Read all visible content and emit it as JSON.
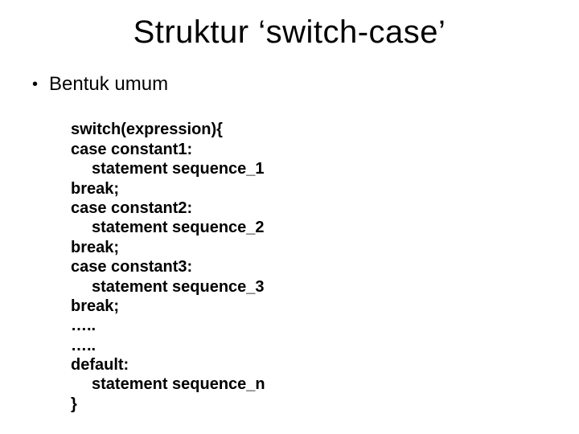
{
  "title": "Struktur ‘switch-case’",
  "bullet": {
    "marker": "•",
    "text": "Bentuk umum"
  },
  "code": {
    "l1": "switch(expression){",
    "l2": "case constant1:",
    "l3": "statement sequence_1",
    "l4": "break;",
    "l5": "case constant2:",
    "l6": "statement sequence_2",
    "l7": "break;",
    "l8": "case constant3:",
    "l9": "statement sequence_3",
    "l10": "break;",
    "l11": "…..",
    "l12": "…..",
    "l13": "default:",
    "l14": "statement sequence_n",
    "l15": "}"
  }
}
